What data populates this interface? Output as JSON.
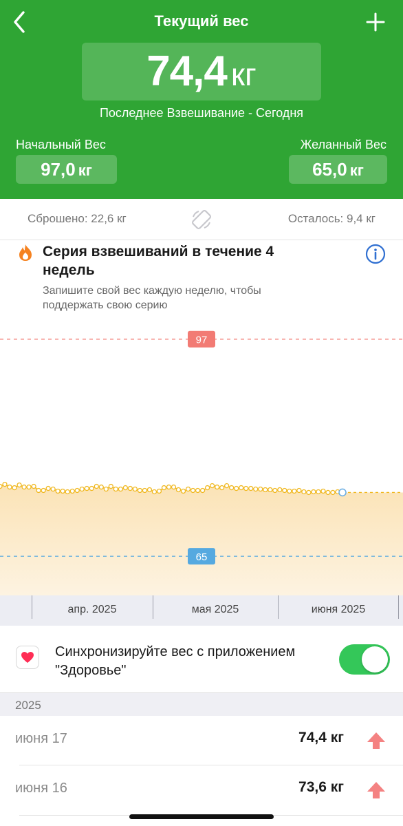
{
  "header": {
    "title": "Текущий вес",
    "current_value": "74,4",
    "current_unit": "кг",
    "last_weighing": "Последнее Взвешивание - Сегодня",
    "start_label": "Начальный Вес",
    "start_value": "97,0",
    "goal_label": "Желанный Вес",
    "goal_value": "65,0",
    "unit": "кг",
    "color": "#2fa534"
  },
  "progress": {
    "lost": "Сброшено: 22,6 кг",
    "left": "Осталось: 9,4 кг"
  },
  "streak": {
    "title": "Серия взвешиваний в течение 4 недель",
    "description": "Запишите свой вес каждую неделю, чтобы поддержать свою серию"
  },
  "chart_data": {
    "type": "line",
    "ylim": [
      64,
      99
    ],
    "reference_lines": [
      {
        "label": "97",
        "value": 97,
        "color": "#f27b74"
      },
      {
        "label": "65",
        "value": 65,
        "color": "#55a9e0"
      }
    ],
    "x_ticks": [
      "апр. 2025",
      "мая 2025",
      "июня 2025"
    ],
    "series": [
      {
        "color": "#f0b820",
        "values": [
          75.3,
          75.6,
          75.2,
          75.1,
          75.5,
          75.2,
          75.2,
          75.3,
          74.7,
          74.7,
          75.0,
          74.9,
          74.6,
          74.6,
          74.5,
          74.6,
          74.7,
          74.9,
          75.0,
          75.0,
          75.3,
          75.2,
          74.9,
          75.3,
          74.9,
          74.9,
          75.1,
          75.0,
          74.9,
          74.7,
          74.7,
          74.8,
          74.5,
          74.6,
          75.1,
          75.2,
          75.2,
          74.8,
          74.6,
          74.9,
          74.7,
          74.7,
          74.7,
          75.1,
          75.4,
          75.2,
          75.1,
          75.4,
          75.1,
          75.0,
          75.1,
          75.0,
          75.0,
          74.9,
          74.9,
          74.8,
          74.8,
          74.7,
          74.8,
          74.7,
          74.6,
          74.6,
          74.7,
          74.5,
          74.4,
          74.5,
          74.5,
          74.6,
          74.4,
          74.4,
          74.5,
          74.4
        ]
      }
    ]
  },
  "sync": {
    "label": "Синхронизируйте вес с приложением \"Здоровье\"",
    "enabled": true
  },
  "history": {
    "year": "2025",
    "entries": [
      {
        "date": "июня 17",
        "weight": "74,4 кг",
        "trend": "up"
      },
      {
        "date": "июня 16",
        "weight": "73,6 кг",
        "trend": "up"
      }
    ]
  }
}
